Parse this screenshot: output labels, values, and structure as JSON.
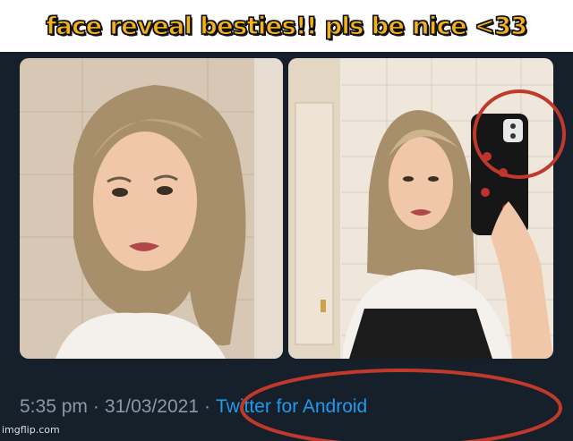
{
  "meme": {
    "caption": "face reveal besties!! pls be nice <33"
  },
  "tweet": {
    "time": "5:35 pm",
    "separator": "·",
    "date": "31/03/2021",
    "source": "Twitter for Android",
    "photos": [
      "selfie-photo",
      "mirror-selfie-photo"
    ]
  },
  "colors": {
    "caption_fill": "#f3b11c",
    "tweet_background": "#15202b",
    "meta_text": "#8b98a5",
    "source_link": "#1d9bf0",
    "annotation_circle": "#c0392b"
  },
  "watermark": "imgflip.com"
}
